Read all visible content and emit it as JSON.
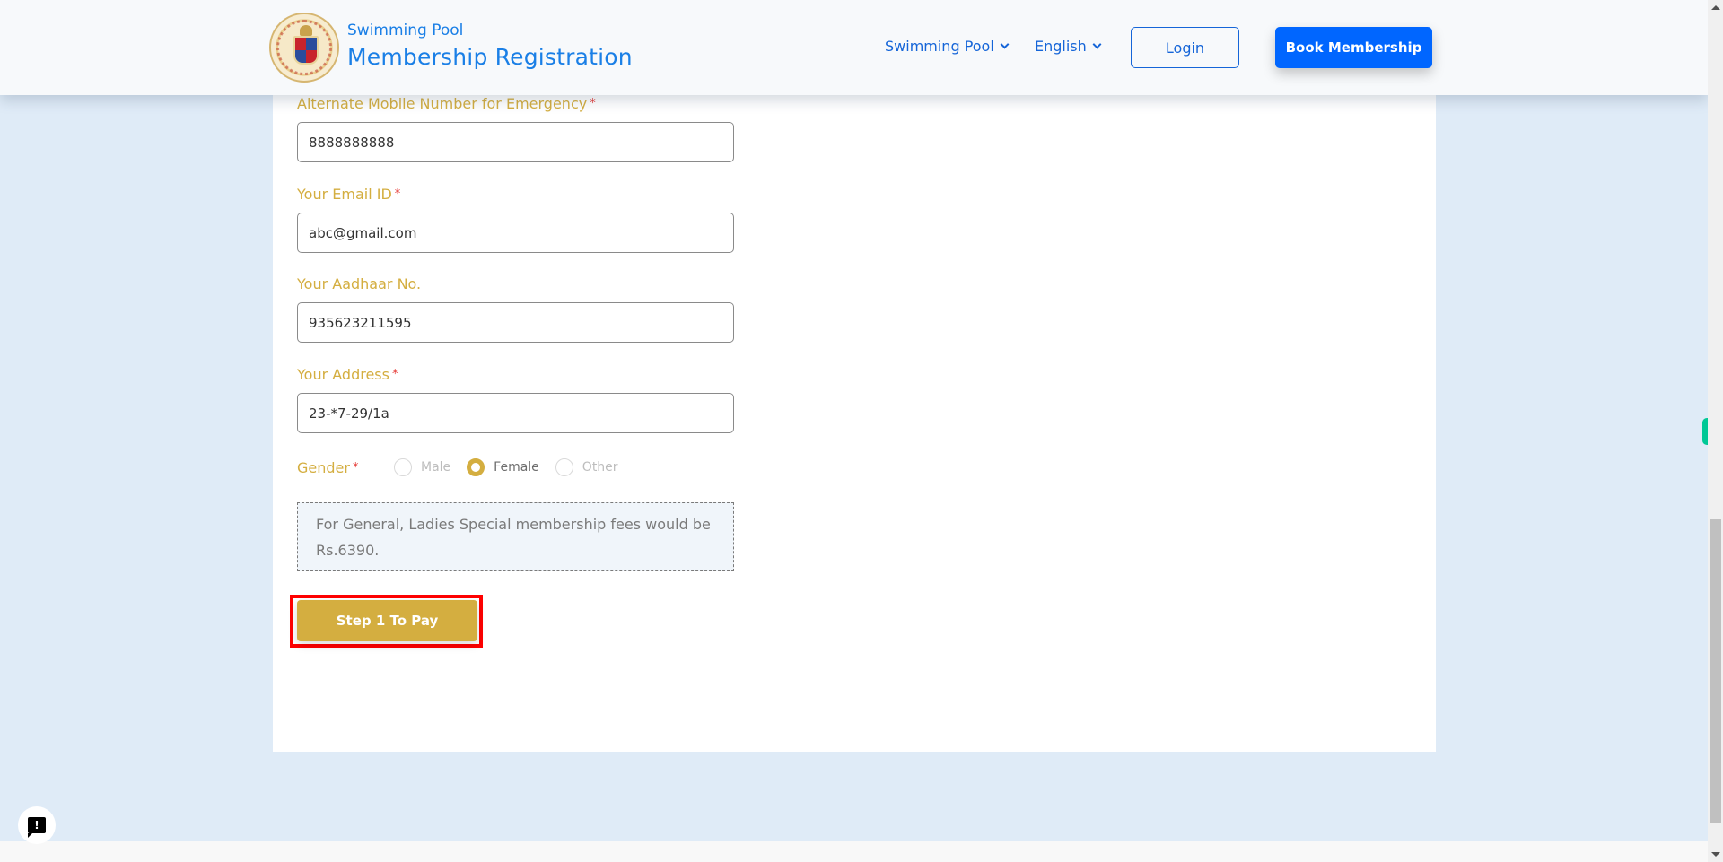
{
  "header": {
    "logo_alt": "Brihanmumbai Municipal Corporation emblem",
    "brand_subtitle": "Swimming Pool",
    "brand_title": "Membership Registration",
    "nav": [
      {
        "label": "Swimming Pool",
        "icon": "chevron-down-icon"
      },
      {
        "label": "English",
        "icon": "chevron-down-icon"
      }
    ],
    "login_label": "Login",
    "book_label": "Book Membership"
  },
  "form": {
    "required_marker": "*",
    "fields": [
      {
        "label": "Alternate Mobile Number for Emergency",
        "required": true,
        "value": "8888888888"
      },
      {
        "label": "Your Email ID",
        "required": true,
        "value": "abc@gmail.com"
      },
      {
        "label": "Your Aadhaar No.",
        "required": false,
        "value": "935623211595"
      },
      {
        "label": "Your Address",
        "required": true,
        "value": "23-*7-29/1a"
      }
    ],
    "gender": {
      "label": "Gender",
      "required": true,
      "options": [
        "Male",
        "Female",
        "Other"
      ],
      "selected": "Female"
    },
    "fee_note": "For General, Ladies Special membership fees would be Rs.6390.",
    "submit_label": "Step 1 To Pay"
  },
  "colors": {
    "accent_gold": "#d4ae40",
    "primary_blue": "#0066ff",
    "link_blue": "#1565d8",
    "required_red": "#e53935",
    "highlight_red": "#ff0000",
    "page_bg": "#dfebf7"
  },
  "widgets": {
    "feedback_icon": "feedback-exclamation-icon"
  }
}
